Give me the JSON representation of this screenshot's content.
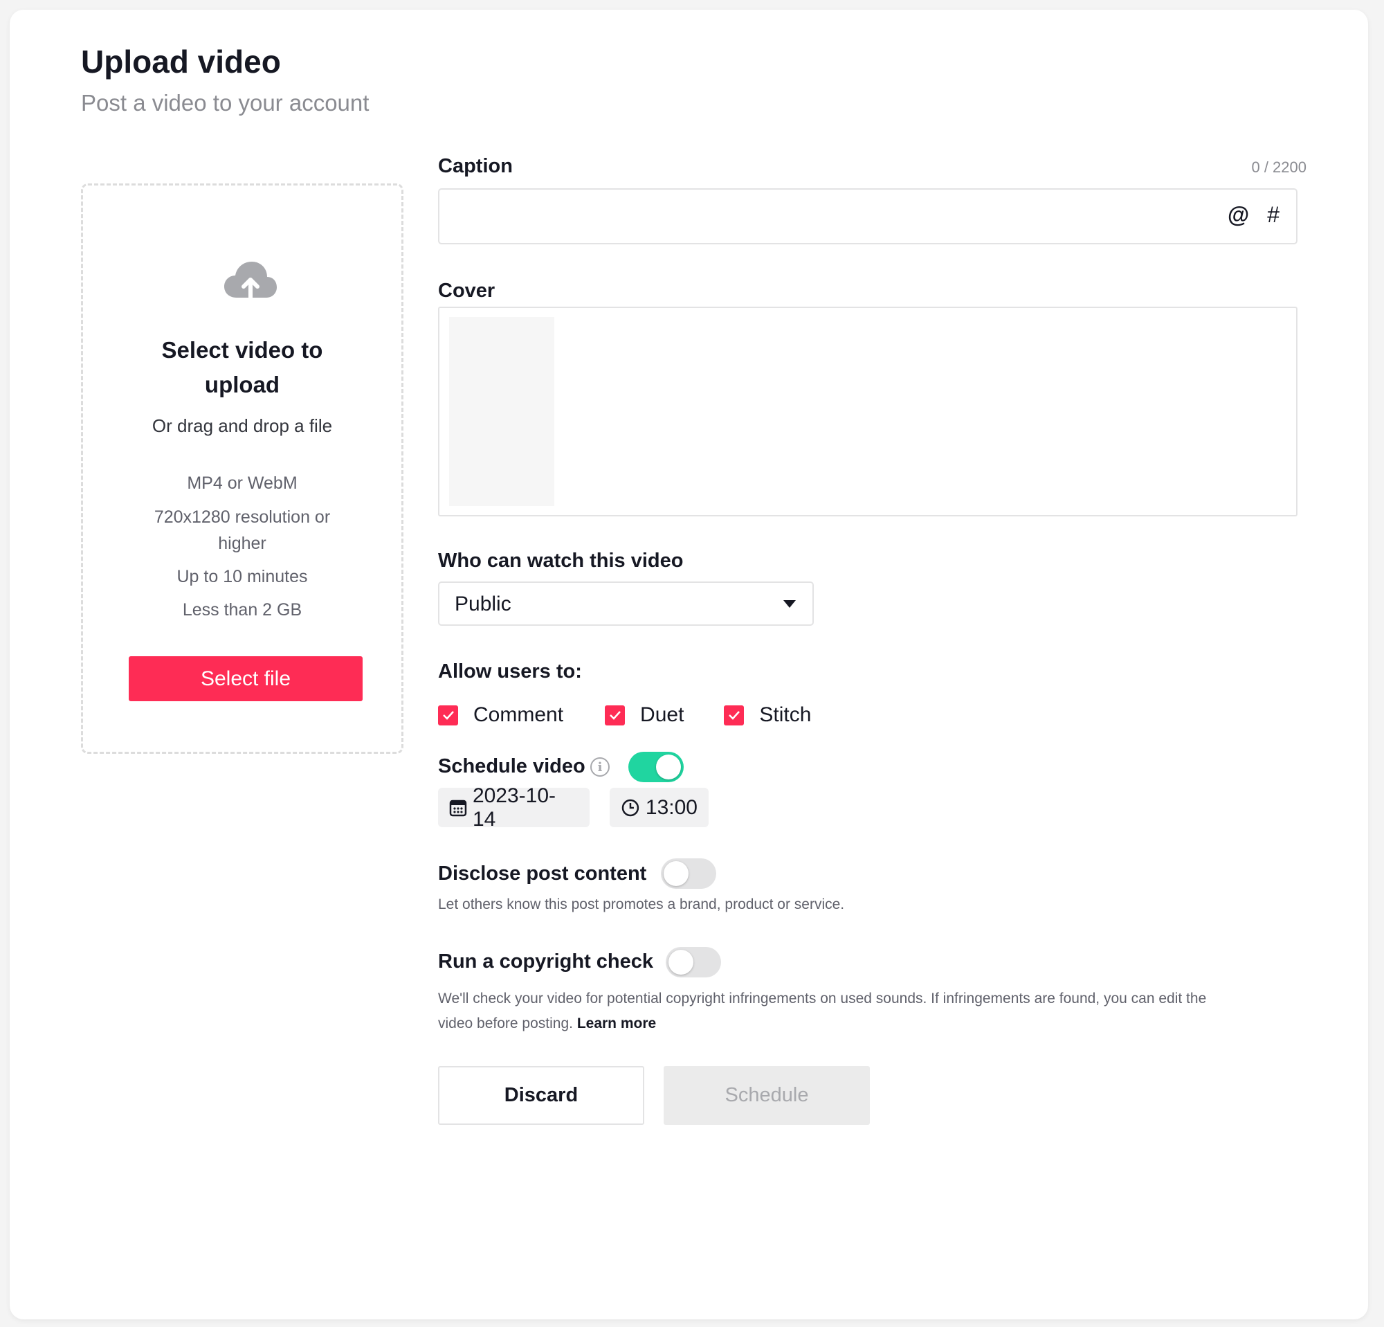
{
  "header": {
    "title": "Upload video",
    "subtitle": "Post a video to your account"
  },
  "upload": {
    "icon": "cloud-upload-icon",
    "heading_line1": "Select video to",
    "heading_line2": "upload",
    "subheading": "Or drag and drop a file",
    "specs": [
      "MP4 or WebM",
      "720x1280 resolution or",
      "higher",
      "Up to 10 minutes",
      "Less than 2 GB"
    ],
    "button_label": "Select file"
  },
  "caption": {
    "label": "Caption",
    "counter": "0 / 2200",
    "value": "",
    "mention_icon": "@",
    "hashtag_icon": "#"
  },
  "cover": {
    "label": "Cover"
  },
  "privacy": {
    "label": "Who can watch this video",
    "selected": "Public"
  },
  "permissions": {
    "label": "Allow users to:",
    "items": [
      {
        "label": "Comment",
        "checked": true
      },
      {
        "label": "Duet",
        "checked": true
      },
      {
        "label": "Stitch",
        "checked": true
      }
    ]
  },
  "schedule": {
    "label": "Schedule video",
    "enabled": true,
    "date": "2023-10-14",
    "time": "13:00"
  },
  "disclose": {
    "label": "Disclose post content",
    "enabled": false,
    "description": "Let others know this post promotes a brand, product or service."
  },
  "copyright": {
    "label": "Run a copyright check",
    "enabled": false,
    "description_line1": "We'll check your video for potential copyright infringements on used sounds. If infringements are found, you can edit the",
    "description_line2": "video before posting.",
    "learn_more": "Learn more"
  },
  "actions": {
    "discard_label": "Discard",
    "schedule_label": "Schedule"
  },
  "colors": {
    "accent": "#fe2c55",
    "toggle_on": "#20d5a0",
    "toggle_off": "#e3e3e4"
  }
}
